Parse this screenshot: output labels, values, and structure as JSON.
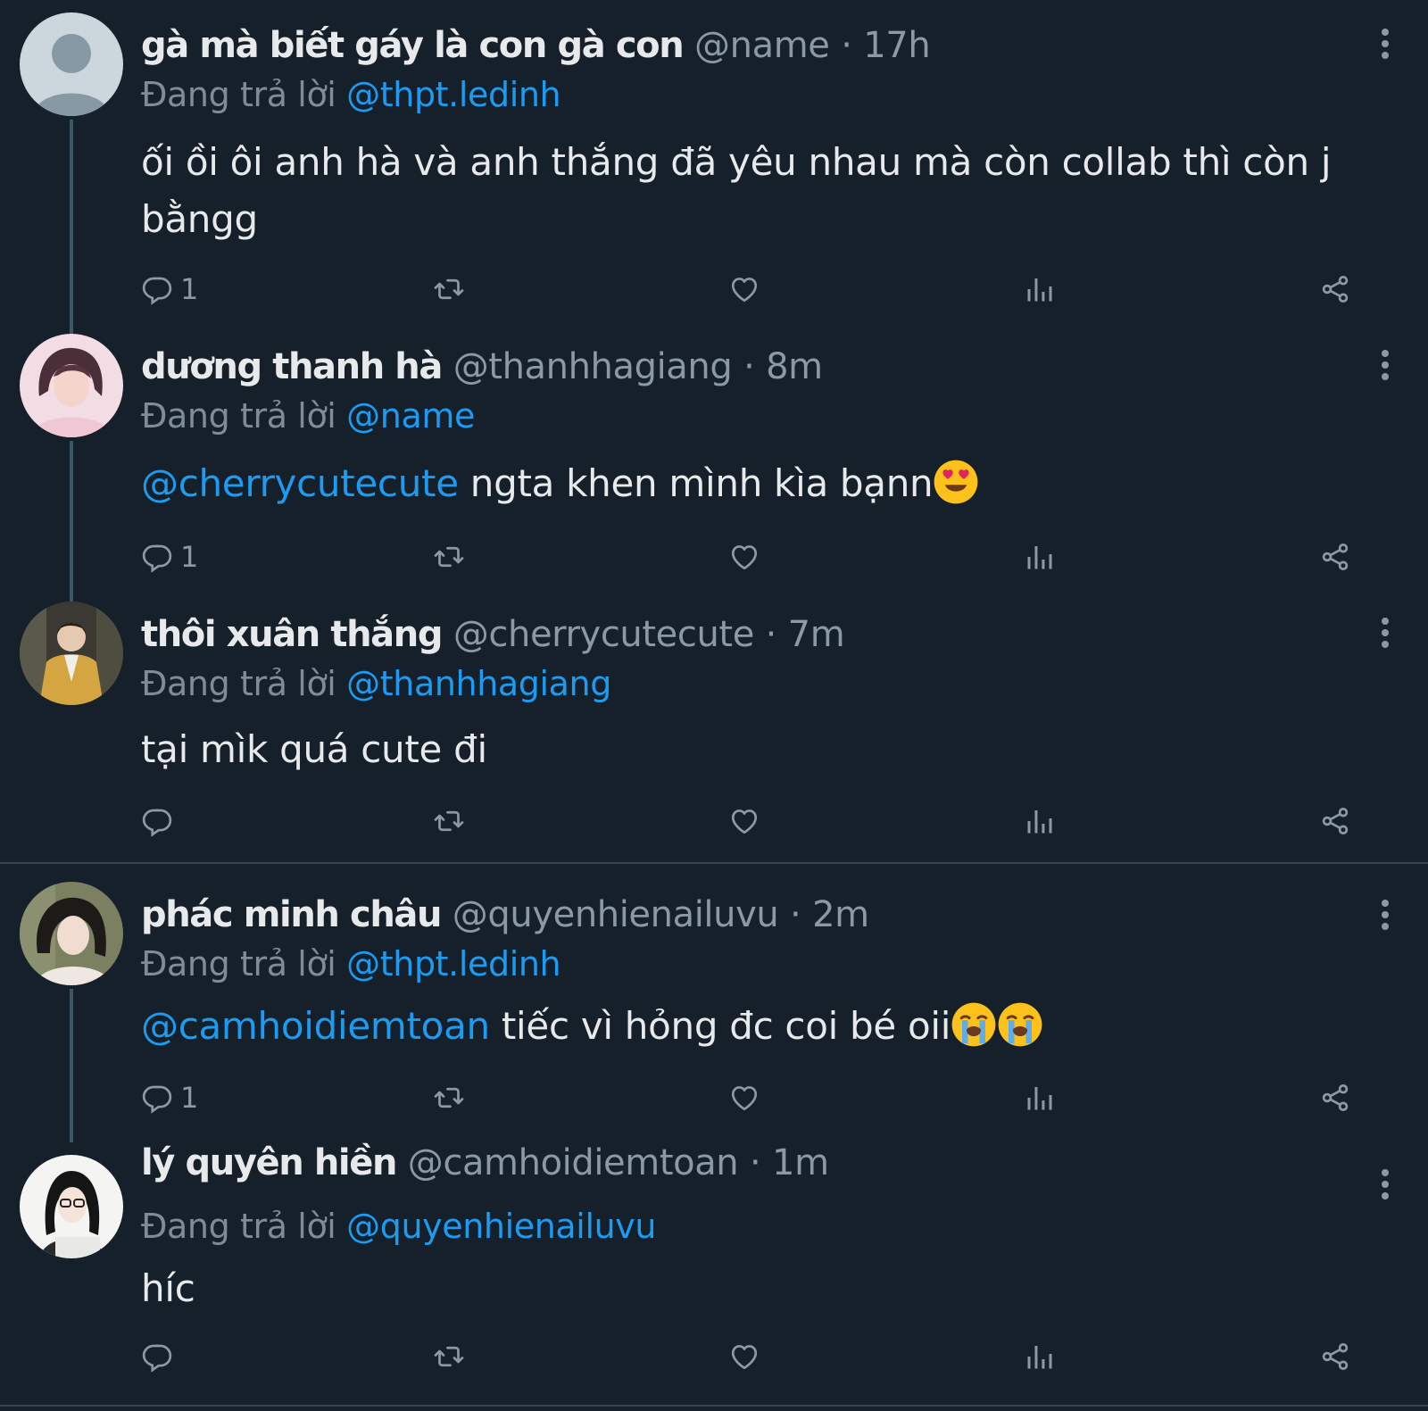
{
  "colors": {
    "background": "#15202b",
    "text": "#e7e9ea",
    "secondary_text": "#8b98a5",
    "mention": "#1d9bf0",
    "thread_line": "#3d5466"
  },
  "tweets": [
    {
      "name": "gà mà biết gáy là con gà con",
      "handle": "@name",
      "separator": "·",
      "time": "17h",
      "replying_label": "Đang trả lời",
      "replying_to": "@thpt.ledinh",
      "mention": "",
      "text": "ối ồi ôi anh hà và anh thắng đã yêu nhau mà còn collab thì còn j bằngg",
      "emojis": [],
      "reply_count": "1",
      "avatar_icon": "default-profile-icon"
    },
    {
      "name": "dương thanh hà",
      "handle": "@thanhhagiang",
      "separator": "·",
      "time": "8m",
      "replying_label": "Đang trả lời",
      "replying_to": "@name",
      "mention": "@cherrycutecute",
      "text": " ngta khen mình kìa bạnn",
      "emojis": [
        "heart-eyes-emoji"
      ],
      "reply_count": "1",
      "avatar_icon": "profile-photo"
    },
    {
      "name": "thôi xuân thắng",
      "handle": "@cherrycutecute",
      "separator": "·",
      "time": "7m",
      "replying_label": "Đang trả lời",
      "replying_to": "@thanhhagiang",
      "mention": "",
      "text": "tại mìk quá cute đi",
      "emojis": [],
      "reply_count": "",
      "avatar_icon": "profile-photo"
    },
    {
      "name": "phác minh châu",
      "handle": "@quyenhienailuvu",
      "separator": "·",
      "time": "2m",
      "replying_label": "Đang trả lời",
      "replying_to": "@thpt.ledinh",
      "mention": "@camhoidiemtoan",
      "text": " tiếc vì hỏng đc coi bé oii",
      "emojis": [
        "crying-emoji",
        "crying-emoji"
      ],
      "reply_count": "1",
      "avatar_icon": "profile-photo"
    },
    {
      "name": "lý quyên hiền",
      "handle": "@camhoidiemtoan",
      "separator": "·",
      "time": "1m",
      "replying_label": "Đang trả lời",
      "replying_to": "@quyenhienailuvu",
      "mention": "",
      "text": "híc",
      "emojis": [],
      "reply_count": "",
      "avatar_icon": "profile-photo"
    }
  ],
  "action_icons": [
    "reply-icon",
    "retweet-icon",
    "like-icon",
    "views-icon",
    "share-icon"
  ]
}
